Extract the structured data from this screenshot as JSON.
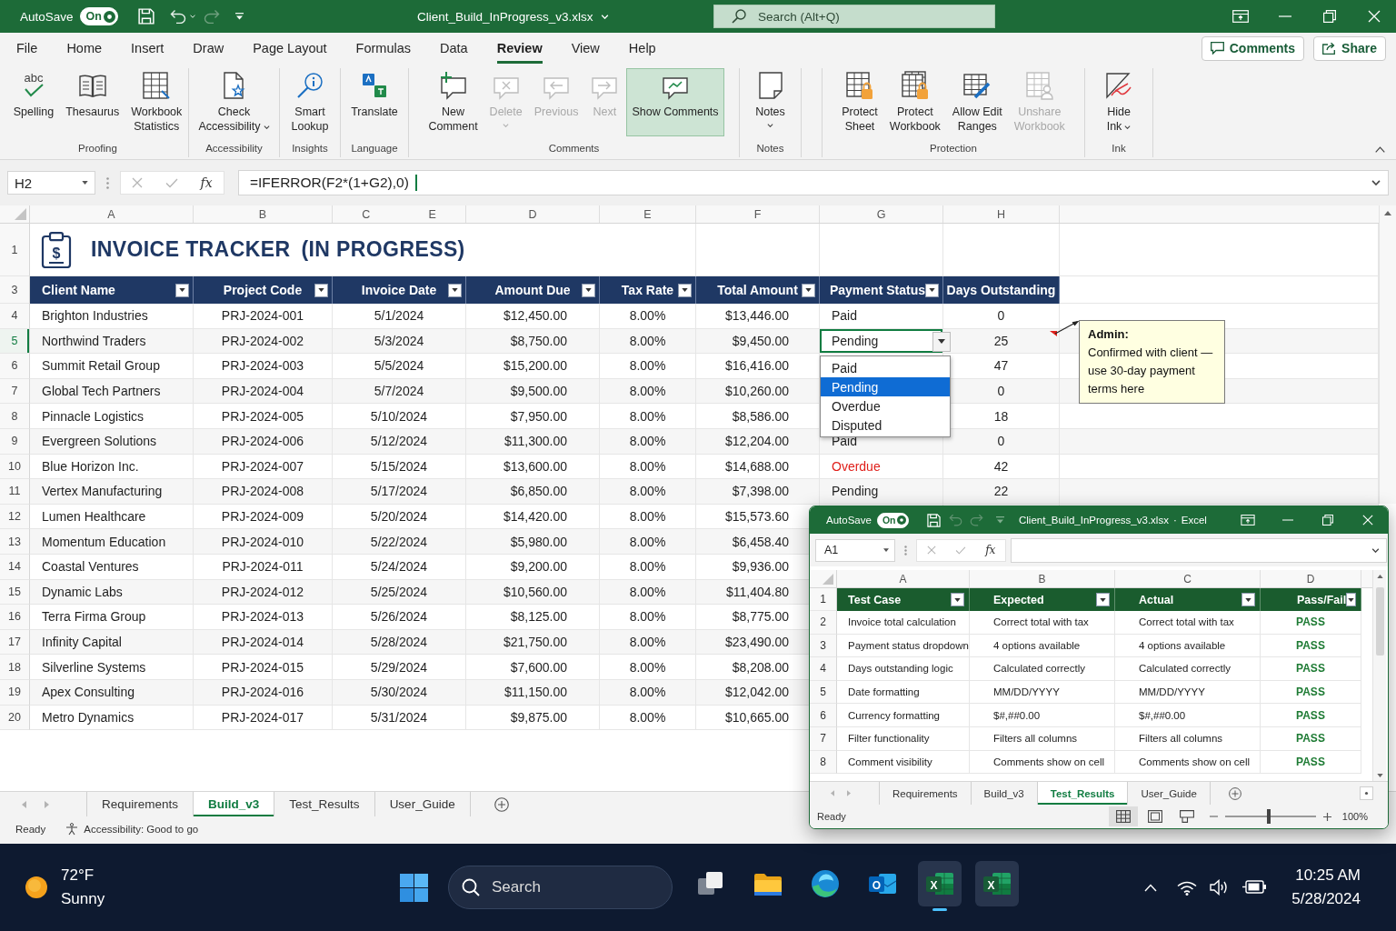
{
  "title_bar": {
    "autosave": {
      "label": "AutoSave",
      "state": "On",
      "on": true
    },
    "undo": {
      "disabled": false
    },
    "redo": {
      "disabled": true
    },
    "file_name": "Client_Build_InProgress_v3.xlsx",
    "search": {
      "placeholder": "Search (Alt+Q)"
    }
  },
  "ribbon": {
    "tabs": [
      {
        "label": "File",
        "selected": false
      },
      {
        "label": "Home",
        "selected": false
      },
      {
        "label": "Insert",
        "selected": false
      },
      {
        "label": "Draw",
        "selected": false
      },
      {
        "label": "Page Layout",
        "selected": false
      },
      {
        "label": "Formulas",
        "selected": false
      },
      {
        "label": "Data",
        "selected": false
      },
      {
        "label": "Review",
        "selected": true
      },
      {
        "label": "View",
        "selected": false
      },
      {
        "label": "Help",
        "selected": false
      }
    ],
    "comments_button": "Comments",
    "share_button": "Share",
    "groups": [
      {
        "name": "Proofing",
        "buttons": [
          {
            "kind": "spelling",
            "icon_text": "abc",
            "lines": [
              "Spelling"
            ],
            "disabled": false,
            "on": false,
            "menu": false
          },
          {
            "kind": "thesaurus",
            "lines": [
              "Thesaurus"
            ],
            "disabled": false,
            "on": false,
            "menu": false
          },
          {
            "kind": "statistics",
            "lines": [
              "Workbook",
              "Statistics"
            ],
            "disabled": false,
            "on": false,
            "menu": false
          }
        ]
      },
      {
        "name": "Accessibility",
        "buttons": [
          {
            "kind": "accessibility",
            "lines": [
              "Check",
              "Accessibility"
            ],
            "disabled": false,
            "on": false,
            "menu": true
          }
        ]
      },
      {
        "name": "Insights",
        "buttons": [
          {
            "kind": "smart_lookup",
            "lines": [
              "Smart",
              "Lookup"
            ],
            "disabled": false,
            "on": false,
            "menu": false
          }
        ]
      },
      {
        "name": "Language",
        "buttons": [
          {
            "kind": "translate",
            "lines": [
              "Translate"
            ],
            "disabled": false,
            "on": false,
            "menu": false
          }
        ]
      },
      {
        "name": "Comments",
        "buttons": [
          {
            "kind": "new_comment",
            "lines": [
              "New",
              "Comment"
            ],
            "disabled": false,
            "on": false,
            "menu": false
          },
          {
            "kind": "delete_comment",
            "lines": [
              "Delete"
            ],
            "disabled": true,
            "on": false,
            "menu": true
          },
          {
            "kind": "previous_comment",
            "lines": [
              "Previous"
            ],
            "disabled": true,
            "on": false,
            "menu": false
          },
          {
            "kind": "next_comment",
            "lines": [
              "Next"
            ],
            "disabled": true,
            "on": false,
            "menu": false
          },
          {
            "kind": "show_comments",
            "lines": [
              "Show Comments"
            ],
            "disabled": false,
            "on": true,
            "menu": false
          }
        ]
      },
      {
        "name": "Notes",
        "buttons": [
          {
            "kind": "notes",
            "lines": [
              "Notes"
            ],
            "disabled": false,
            "on": false,
            "menu": true
          }
        ]
      },
      {
        "name": "Protection",
        "buttons": [
          {
            "kind": "protect_sheet",
            "lines": [
              "Protect",
              "Sheet"
            ],
            "disabled": false,
            "on": false,
            "menu": false
          },
          {
            "kind": "protect_workbook",
            "lines": [
              "Protect",
              "Workbook"
            ],
            "disabled": false,
            "on": false,
            "menu": false
          },
          {
            "kind": "allow_edit",
            "lines": [
              "Allow Edit",
              "Ranges"
            ],
            "disabled": false,
            "on": false,
            "menu": false
          },
          {
            "kind": "unshare",
            "lines": [
              "Unshare",
              "Workbook"
            ],
            "disabled": true,
            "on": false,
            "menu": false
          }
        ]
      },
      {
        "name": "Ink",
        "buttons": [
          {
            "kind": "hide_ink",
            "lines": [
              "Hide",
              "Ink"
            ],
            "disabled": false,
            "on": false,
            "menu": true
          }
        ]
      }
    ]
  },
  "formula_bar": {
    "name_box": "H2",
    "function_label": "fx",
    "formula": "=IFERROR(F2*(1+G2),0)"
  },
  "sheet": {
    "column_headers": [
      {
        "letters": [
          "A"
        ]
      },
      {
        "letters": [
          "B"
        ]
      },
      {
        "letters": [
          "C",
          "E"
        ]
      },
      {
        "letters": [
          "D"
        ]
      },
      {
        "letters": [
          "E"
        ]
      },
      {
        "letters": [
          "F"
        ]
      },
      {
        "letters": [
          "G"
        ]
      },
      {
        "letters": [
          "H"
        ]
      }
    ],
    "title_row": {
      "row_number": "1",
      "icon_symbol": "$",
      "title": "INVOICE TRACKER",
      "note": "(IN PROGRESS)"
    },
    "header_row": {
      "row_number": "3",
      "columns": [
        {
          "label": "Client Name",
          "filter": true
        },
        {
          "label": "Project Code",
          "filter": true
        },
        {
          "label": "Invoice Date",
          "filter": true
        },
        {
          "label": "Amount Due",
          "filter": true
        },
        {
          "label": "Tax Rate",
          "filter": true
        },
        {
          "label": "Total Amount",
          "filter": true
        },
        {
          "label": "Payment Status",
          "filter": true
        },
        {
          "label": "Days Outstanding",
          "filter": false
        }
      ]
    },
    "rows": [
      {
        "row_number": "4",
        "selected": false,
        "cells": [
          "Brighton Industries",
          "PRJ-2024-001",
          "5/1/2024",
          "$12,450.00",
          "8.00%",
          "$13,446.00"
        ],
        "status": {
          "text": "Paid",
          "color": "#1f1f1f",
          "active": false
        },
        "days": "0"
      },
      {
        "row_number": "5",
        "selected": true,
        "cells": [
          "Northwind Traders",
          "PRJ-2024-002",
          "5/3/2024",
          "$8,750.00",
          "8.00%",
          "$9,450.00"
        ],
        "status": {
          "text": "Pending",
          "color": "#1f1f1f",
          "active": true
        },
        "days": "25"
      },
      {
        "row_number": "6",
        "selected": false,
        "cells": [
          "Summit Retail Group",
          "PRJ-2024-003",
          "5/5/2024",
          "$15,200.00",
          "8.00%",
          "$16,416.00"
        ],
        "days": "47"
      },
      {
        "row_number": "7",
        "selected": false,
        "cells": [
          "Global Tech Partners",
          "PRJ-2024-004",
          "5/7/2024",
          "$9,500.00",
          "8.00%",
          "$10,260.00"
        ],
        "days": "0"
      },
      {
        "row_number": "8",
        "selected": false,
        "cells": [
          "Pinnacle Logistics",
          "PRJ-2024-005",
          "5/10/2024",
          "$7,950.00",
          "8.00%",
          "$8,586.00"
        ],
        "days": "18"
      },
      {
        "row_number": "9",
        "selected": false,
        "cells": [
          "Evergreen Solutions",
          "PRJ-2024-006",
          "5/12/2024",
          "$11,300.00",
          "8.00%",
          "$12,204.00"
        ],
        "status": {
          "text": "Paid",
          "color": "#1f1f1f",
          "active": false
        },
        "days": "0"
      },
      {
        "row_number": "10",
        "selected": false,
        "cells": [
          "Blue Horizon Inc.",
          "PRJ-2024-007",
          "5/15/2024",
          "$13,600.00",
          "8.00%",
          "$14,688.00"
        ],
        "status": {
          "text": "Overdue",
          "color": "#e0201b",
          "active": false
        },
        "days": "42"
      },
      {
        "row_number": "11",
        "selected": false,
        "cells": [
          "Vertex Manufacturing",
          "PRJ-2024-008",
          "5/17/2024",
          "$6,850.00",
          "8.00%",
          "$7,398.00"
        ],
        "status": {
          "text": "Pending",
          "color": "#1f1f1f",
          "active": false
        },
        "days": "22"
      },
      {
        "row_number": "12",
        "selected": false,
        "cells": [
          "Lumen Healthcare",
          "PRJ-2024-009",
          "5/20/2024",
          "$14,420.00",
          "8.00%",
          "$15,573.60"
        ]
      },
      {
        "row_number": "13",
        "selected": false,
        "cells": [
          "Momentum Education",
          "PRJ-2024-010",
          "5/22/2024",
          "$5,980.00",
          "8.00%",
          "$6,458.40"
        ]
      },
      {
        "row_number": "14",
        "selected": false,
        "cells": [
          "Coastal Ventures",
          "PRJ-2024-011",
          "5/24/2024",
          "$9,200.00",
          "8.00%",
          "$9,936.00"
        ]
      },
      {
        "row_number": "15",
        "selected": false,
        "cells": [
          "Dynamic Labs",
          "PRJ-2024-012",
          "5/25/2024",
          "$10,560.00",
          "8.00%",
          "$11,404.80"
        ]
      },
      {
        "row_number": "16",
        "selected": false,
        "cells": [
          "Terra Firma Group",
          "PRJ-2024-013",
          "5/26/2024",
          "$8,125.00",
          "8.00%",
          "$8,775.00"
        ]
      },
      {
        "row_number": "17",
        "selected": false,
        "cells": [
          "Infinity Capital",
          "PRJ-2024-014",
          "5/28/2024",
          "$21,750.00",
          "8.00%",
          "$23,490.00"
        ]
      },
      {
        "row_number": "18",
        "selected": false,
        "cells": [
          "Silverline Systems",
          "PRJ-2024-015",
          "5/29/2024",
          "$7,600.00",
          "8.00%",
          "$8,208.00"
        ]
      },
      {
        "row_number": "19",
        "selected": false,
        "cells": [
          "Apex Consulting",
          "PRJ-2024-016",
          "5/30/2024",
          "$11,150.00",
          "8.00%",
          "$12,042.00"
        ]
      },
      {
        "row_number": "20",
        "selected": false,
        "cells": [
          "Metro Dynamics",
          "PRJ-2024-017",
          "5/31/2024",
          "$9,875.00",
          "8.00%",
          "$10,665.00"
        ]
      }
    ]
  },
  "status_dropdown": {
    "options": [
      {
        "label": "Paid",
        "selected": false
      },
      {
        "label": "Pending",
        "selected": true
      },
      {
        "label": "Overdue",
        "selected": false
      },
      {
        "label": "Disputed",
        "selected": false
      }
    ]
  },
  "comment": {
    "author": "Admin:",
    "text": "Confirmed with client — use 30-day payment terms here"
  },
  "sheet_tabs": [
    {
      "label": "Requirements",
      "selected": false
    },
    {
      "label": "Build_v3",
      "selected": true
    },
    {
      "label": "Test_Results",
      "selected": false
    },
    {
      "label": "User_Guide",
      "selected": false
    }
  ],
  "status_bar": {
    "ready": "Ready",
    "accessibility": "Accessibility: Good to go"
  },
  "second_window": {
    "title_bar": {
      "autosave": {
        "label": "AutoSave",
        "state": "On",
        "on": true
      },
      "undo": {
        "disabled": true
      },
      "redo": {
        "disabled": true
      },
      "file_name": "Client_Build_InProgress_v3.xlsx",
      "separator": "·",
      "app_name": "Excel"
    },
    "formula_bar": {
      "name_box": "A1",
      "function_label": "fx"
    },
    "column_headers": [
      "A",
      "B",
      "C",
      "D"
    ],
    "header_row": {
      "row_number": "1",
      "columns": [
        {
          "label": "Test Case",
          "filter": true
        },
        {
          "label": "Expected",
          "filter": true
        },
        {
          "label": "Actual",
          "filter": true
        },
        {
          "label": "Pass/Fail",
          "filter": true
        }
      ]
    },
    "rows": [
      {
        "row_number": "2",
        "cells": [
          "Invoice total calculation",
          "Correct total with tax",
          "Correct total with tax"
        ],
        "result": "PASS"
      },
      {
        "row_number": "3",
        "cells": [
          "Payment status dropdown",
          "4 options available",
          "4 options available"
        ],
        "result": "PASS"
      },
      {
        "row_number": "4",
        "cells": [
          "Days outstanding logic",
          "Calculated correctly",
          "Calculated correctly"
        ],
        "result": "PASS"
      },
      {
        "row_number": "5",
        "cells": [
          "Date formatting",
          "MM/DD/YYYY",
          "MM/DD/YYYY"
        ],
        "result": "PASS"
      },
      {
        "row_number": "6",
        "cells": [
          "Currency formatting",
          "$#,##0.00",
          "$#,##0.00"
        ],
        "result": "PASS"
      },
      {
        "row_number": "7",
        "cells": [
          "Filter functionality",
          "Filters all columns",
          "Filters all columns"
        ],
        "result": "PASS"
      },
      {
        "row_number": "8",
        "cells": [
          "Comment visibility",
          "Comments show on cell",
          "Comments show on cell"
        ],
        "result": "PASS"
      }
    ],
    "sheet_tabs": [
      {
        "label": "Requirements",
        "selected": false
      },
      {
        "label": "Build_v3",
        "selected": false
      },
      {
        "label": "Test_Results",
        "selected": true
      },
      {
        "label": "User_Guide",
        "selected": false
      }
    ],
    "status_bar": {
      "ready": "Ready",
      "views": [
        {
          "kind": "normal",
          "selected": true
        },
        {
          "kind": "page_layout",
          "selected": false
        },
        {
          "kind": "page_break",
          "selected": false
        }
      ],
      "zoom": {
        "level": 0.48,
        "reading": "100%"
      }
    }
  },
  "taskbar": {
    "weather": {
      "temperature": "72°F",
      "condition": "Sunny"
    },
    "search": {
      "placeholder": "Search"
    },
    "apps": [
      {
        "kind": "task_view",
        "open": false,
        "selected": false
      },
      {
        "kind": "file_explorer",
        "open": false,
        "selected": false
      },
      {
        "kind": "browser",
        "open": false,
        "selected": false
      },
      {
        "kind": "mail",
        "logo_letter": "O",
        "open": false,
        "selected": false
      },
      {
        "kind": "spreadsheet",
        "logo_letter": "X",
        "open": true,
        "selected": true
      },
      {
        "kind": "spreadsheet",
        "logo_letter": "X",
        "open": true,
        "selected": false
      }
    ],
    "clock": {
      "time": "10:25 AM",
      "date": "5/28/2024"
    }
  }
}
